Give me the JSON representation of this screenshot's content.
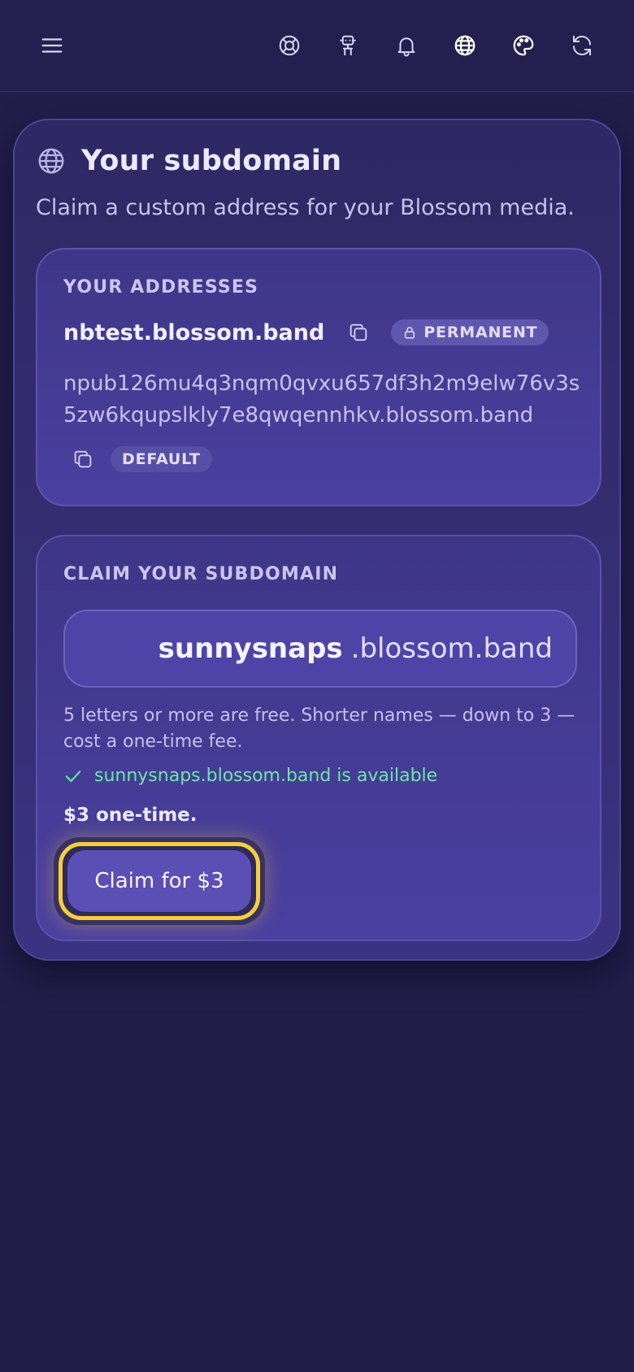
{
  "topbar": {
    "icons": [
      "menu-icon",
      "lifebuoy-icon",
      "robot-icon",
      "bell-icon",
      "globe-icon",
      "palette-icon",
      "refresh-icon"
    ]
  },
  "card": {
    "title": "Your subdomain",
    "subtitle": "Claim a custom address for your Blossom media."
  },
  "addresses": {
    "section_label": "YOUR ADDRESSES",
    "primary": "nbtest.blossom.band",
    "primary_badge": "PERMANENT",
    "npub": "npub126mu4q3nqm0qvxu657df3h2m9elw76v3s5zw6kqupslkly7e8qwqennhkv.blossom.band",
    "npub_badge": "DEFAULT"
  },
  "claim": {
    "section_label": "CLAIM YOUR SUBDOMAIN",
    "input_value": "sunnysnaps",
    "suffix": ".blossom.band",
    "hint": "5 letters or more are free. Shorter names — down to 3 — cost a one-time fee.",
    "availability": "sunnysnaps.blossom.band is available",
    "price": "$3 one-time.",
    "button_label": "Claim for $3"
  },
  "colors": {
    "background": "#221e4a",
    "accent": "#5b4fb5",
    "focus_ring": "#f6cd3f",
    "success": "#6ee6a8"
  }
}
